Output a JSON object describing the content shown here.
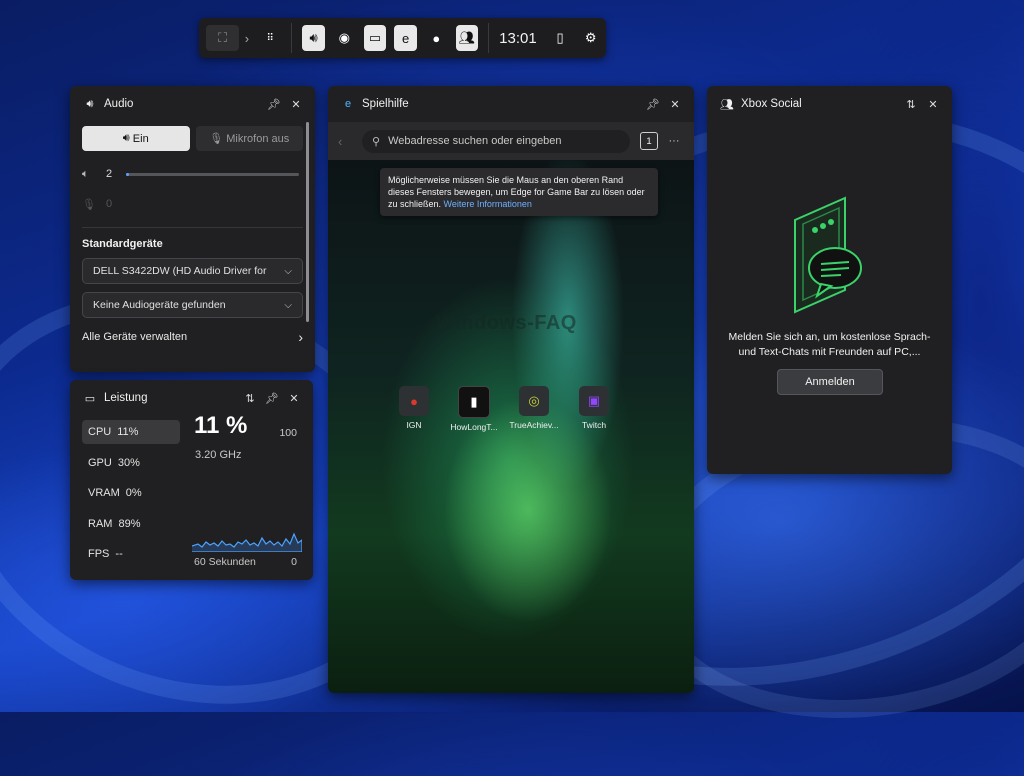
{
  "gamebar": {
    "time": "13:01",
    "icons": [
      "widget-home-icon",
      "chevron-right-icon",
      "widget-menu-icon",
      "audio-icon",
      "capture-icon",
      "performance-icon",
      "edge-icon",
      "tips-icon",
      "xbox-social-icon",
      "mouse-icon",
      "settings-icon"
    ]
  },
  "audio": {
    "title": "Audio",
    "output_on": "Ein",
    "mic_off": "Mikrofon aus",
    "volume_value": "2",
    "volume_level": 0.02,
    "mic_value": "0",
    "section_title": "Standardgeräte",
    "output_device": "DELL S3422DW (HD Audio Driver for",
    "input_device": "Keine Audiogeräte gefunden",
    "manage_label": "Alle Geräte verwalten"
  },
  "performance": {
    "title": "Leistung",
    "items": [
      {
        "label": "CPU",
        "value": "11%"
      },
      {
        "label": "GPU",
        "value": "30%"
      },
      {
        "label": "VRAM",
        "value": "0%"
      },
      {
        "label": "RAM",
        "value": "89%"
      },
      {
        "label": "FPS",
        "value": "--"
      }
    ],
    "big_value": "11 %",
    "clock": "3.20 GHz",
    "max_label": "100",
    "window_label": "60 Sekunden",
    "min_label": "0"
  },
  "browser": {
    "title": "Spielhilfe",
    "address_placeholder": "Webadresse suchen oder eingeben",
    "tab_count": "1",
    "tooltip_text": "Möglicherweise müssen Sie die Maus an den oberen Rand dieses Fensters bewegen, um Edge for Game Bar zu lösen oder zu schließen.",
    "tooltip_link": "Weitere Informationen",
    "watermark": "Windows-FAQ",
    "tiles": [
      {
        "label": "IGN",
        "icon": "ign-icon",
        "color": "#d83b2e"
      },
      {
        "label": "HowLongT...",
        "icon": "howlongtobeat-icon",
        "color": "#ffffff"
      },
      {
        "label": "TrueAchiev...",
        "icon": "trueachievements-icon",
        "color": "#c7d43a"
      },
      {
        "label": "Twitch",
        "icon": "twitch-icon",
        "color": "#9146ff"
      }
    ]
  },
  "xbox": {
    "title": "Xbox Social",
    "message": "Melden Sie sich an, um kostenlose Sprach- und Text-Chats mit Freunden auf PC,...",
    "signin_label": "Anmelden",
    "accent": "#3ad36a"
  }
}
